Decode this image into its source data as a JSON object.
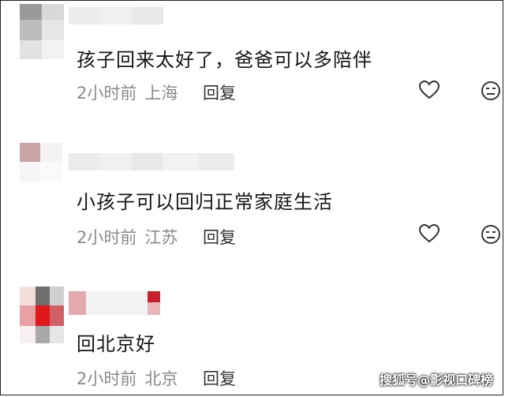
{
  "comments": [
    {
      "text": "孩子回来太好了，爸爸可以多陪伴",
      "time": "2小时前",
      "location": "上海",
      "reply_label": "回复"
    },
    {
      "text": "小孩子可以回归正常家庭生活",
      "time": "2小时前",
      "location": "江苏",
      "reply_label": "回复"
    },
    {
      "text": "回北京好",
      "time": "2小时前",
      "location": "北京",
      "reply_label": "回复"
    }
  ],
  "icons": {
    "like": "heart-icon",
    "dislike": "neutral-face-icon"
  },
  "watermark": "搜狐号@影视口碑榜",
  "colors": {
    "meta_text": "#8a8a8a",
    "body_text": "#151515",
    "avatar_red": "#e0171b"
  }
}
